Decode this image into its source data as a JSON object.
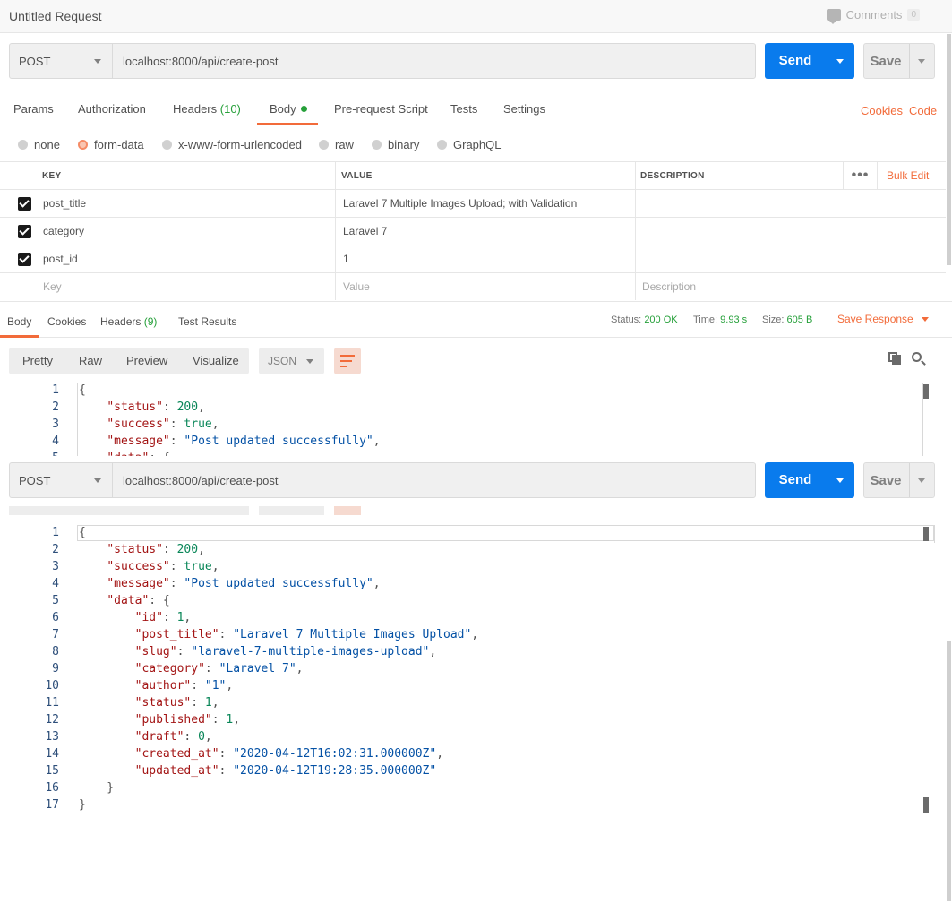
{
  "title": "Untitled Request",
  "comments": {
    "label": "Comments",
    "count": "0"
  },
  "request": {
    "method": "POST",
    "url": "localhost:8000/api/create-post",
    "send_label": "Send",
    "save_label": "Save"
  },
  "request_tabs": {
    "params": "Params",
    "authorization": "Authorization",
    "headers": "Headers",
    "headers_count": "(10)",
    "body": "Body",
    "prerequest": "Pre-request Script",
    "tests": "Tests",
    "settings": "Settings",
    "cookies": "Cookies",
    "code": "Code"
  },
  "body_types": [
    "none",
    "form-data",
    "x-www-form-urlencoded",
    "raw",
    "binary",
    "GraphQL"
  ],
  "params_table": {
    "headers": {
      "key": "KEY",
      "value": "VALUE",
      "description": "DESCRIPTION",
      "bulk_edit": "Bulk Edit"
    },
    "rows": [
      {
        "key": "post_title",
        "value": "Laravel 7 Multiple Images Upload; with Validation",
        "checked": true
      },
      {
        "key": "category",
        "value": "Laravel 7",
        "checked": true
      },
      {
        "key": "post_id",
        "value": "1",
        "checked": true
      }
    ],
    "placeholders": {
      "key": "Key",
      "value": "Value",
      "description": "Description"
    }
  },
  "response_tabs": {
    "body": "Body",
    "cookies": "Cookies",
    "headers": "Headers",
    "headers_count": "(9)",
    "test_results": "Test Results"
  },
  "response_meta": {
    "status_label": "Status:",
    "status_value": "200 OK",
    "time_label": "Time:",
    "time_value": "9.93 s",
    "size_label": "Size:",
    "size_value": "605 B",
    "save_response": "Save Response"
  },
  "view_modes": [
    "Pretty",
    "Raw",
    "Preview",
    "Visualize"
  ],
  "format": "JSON",
  "code_lines": [
    [
      [
        "p",
        "{"
      ]
    ],
    [
      [
        "p",
        "    "
      ],
      [
        "k",
        "\"status\""
      ],
      [
        "p",
        ": "
      ],
      [
        "n",
        "200"
      ],
      [
        "p",
        ","
      ]
    ],
    [
      [
        "p",
        "    "
      ],
      [
        "k",
        "\"success\""
      ],
      [
        "p",
        ": "
      ],
      [
        "n",
        "true"
      ],
      [
        "p",
        ","
      ]
    ],
    [
      [
        "p",
        "    "
      ],
      [
        "k",
        "\"message\""
      ],
      [
        "p",
        ": "
      ],
      [
        "s",
        "\"Post updated successfully\""
      ],
      [
        "p",
        ","
      ]
    ],
    [
      [
        "p",
        "    "
      ],
      [
        "k",
        "\"data\""
      ],
      [
        "p",
        ": {"
      ]
    ],
    [
      [
        "p",
        "        "
      ],
      [
        "k",
        "\"id\""
      ],
      [
        "p",
        ": "
      ],
      [
        "n",
        "1"
      ],
      [
        "p",
        ","
      ]
    ],
    [
      [
        "p",
        "        "
      ],
      [
        "k",
        "\"post_title\""
      ],
      [
        "p",
        ": "
      ],
      [
        "s",
        "\"Laravel 7 Multiple Images Upload\""
      ],
      [
        "p",
        ","
      ]
    ],
    [
      [
        "p",
        "        "
      ],
      [
        "k",
        "\"slug\""
      ],
      [
        "p",
        ": "
      ],
      [
        "s",
        "\"laravel-7-multiple-images-upload\""
      ],
      [
        "p",
        ","
      ]
    ],
    [
      [
        "p",
        "        "
      ],
      [
        "k",
        "\"category\""
      ],
      [
        "p",
        ": "
      ],
      [
        "s",
        "\"Laravel 7\""
      ],
      [
        "p",
        ","
      ]
    ],
    [
      [
        "p",
        "        "
      ],
      [
        "k",
        "\"author\""
      ],
      [
        "p",
        ": "
      ],
      [
        "s",
        "\"1\""
      ],
      [
        "p",
        ","
      ]
    ],
    [
      [
        "p",
        "        "
      ],
      [
        "k",
        "\"status\""
      ],
      [
        "p",
        ": "
      ],
      [
        "n",
        "1"
      ],
      [
        "p",
        ","
      ]
    ],
    [
      [
        "p",
        "        "
      ],
      [
        "k",
        "\"published\""
      ],
      [
        "p",
        ": "
      ],
      [
        "n",
        "1"
      ],
      [
        "p",
        ","
      ]
    ],
    [
      [
        "p",
        "        "
      ],
      [
        "k",
        "\"draft\""
      ],
      [
        "p",
        ": "
      ],
      [
        "n",
        "0"
      ],
      [
        "p",
        ","
      ]
    ],
    [
      [
        "p",
        "        "
      ],
      [
        "k",
        "\"created_at\""
      ],
      [
        "p",
        ": "
      ],
      [
        "s",
        "\"2020-04-12T16:02:31.000000Z\""
      ],
      [
        "p",
        ","
      ]
    ],
    [
      [
        "p",
        "        "
      ],
      [
        "k",
        "\"updated_at\""
      ],
      [
        "p",
        ": "
      ],
      [
        "s",
        "\"2020-04-12T19:28:35.000000Z\""
      ]
    ],
    [
      [
        "p",
        "    }"
      ]
    ],
    [
      [
        "p",
        "}"
      ]
    ]
  ]
}
